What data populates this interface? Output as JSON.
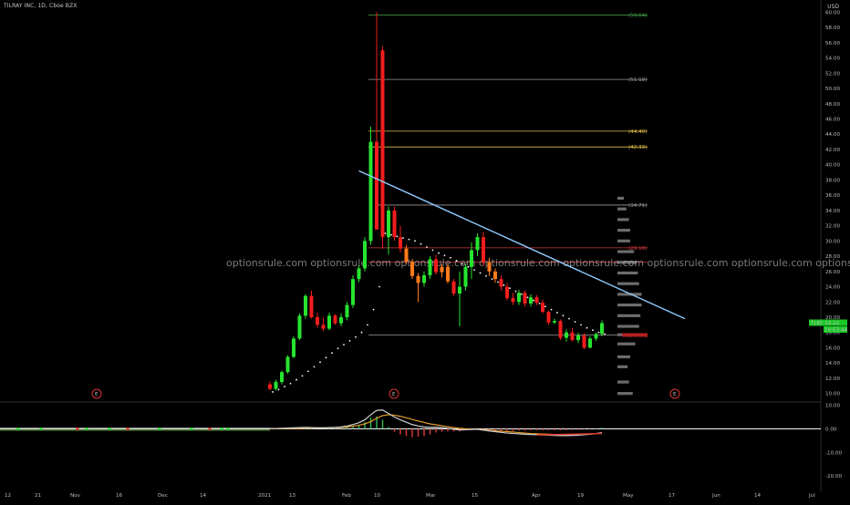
{
  "header": {
    "symbol": "TILRAY INC, 1D, Cboe BZX",
    "currency": "USD"
  },
  "watermark": "optionsrule.com optionsrule.com optionsrule.com optionsrule.com optionsrule.com optionsrule.com optionsrule.com optionsrule.com optionsrule.com optionsrule.com optionsrule.com",
  "price_tags": {
    "last": "TLRY 19.22",
    "countdown": "19:53:44"
  },
  "event_marker": "E",
  "colors": {
    "up": "#26e52f",
    "down": "#f21d1d",
    "pullback": "#ff7a1a",
    "trendline": "#8ecbff",
    "dots": "#ffffff",
    "level_green": "#48a84a",
    "level_gray": "#9a9a9a",
    "level_yellow": "#e0c24a",
    "level_red": "#d83a3a"
  },
  "chart_data": [
    {
      "type": "candlestick",
      "title": "TILRAY INC, 1D, Cboe BZX",
      "ylabel": "USD",
      "ylim": [
        9,
        61
      ],
      "y_ticks": [
        "10.00",
        "12.00",
        "14.00",
        "16.00",
        "18.00",
        "20.00",
        "22.00",
        "24.00",
        "26.00",
        "28.00",
        "30.00",
        "32.00",
        "34.00",
        "36.00",
        "38.00",
        "40.00",
        "42.00",
        "44.00",
        "46.00",
        "48.00",
        "50.00",
        "52.00",
        "54.00",
        "56.00",
        "58.00",
        "60.00"
      ],
      "x_ticks": [
        "12",
        "21",
        "Nov",
        "16",
        "Dec",
        "14",
        "2021",
        "13",
        "Feb",
        "10",
        "Mar",
        "15",
        "Apr",
        "19",
        "May",
        "17",
        "Jun",
        "14",
        "Jul"
      ],
      "levels": [
        {
          "label": "(59.64)",
          "value": 59.64,
          "color": "green"
        },
        {
          "label": "(51.18)",
          "value": 51.18,
          "color": "gray"
        },
        {
          "label": "(44.40)",
          "value": 44.4,
          "color": "yellow"
        },
        {
          "label": "(42.33)",
          "value": 42.33,
          "color": "yellow"
        },
        {
          "label": "(34.71)",
          "value": 34.71,
          "color": "gray"
        },
        {
          "label": "(29.10)",
          "value": 29.1,
          "color": "red"
        },
        {
          "label": "(17.67)",
          "value": 17.67,
          "color": "gray"
        }
      ],
      "candles": [
        {
          "o": 11.2,
          "h": 11.6,
          "l": 10.4,
          "c": 10.6
        },
        {
          "o": 10.6,
          "h": 11.8,
          "l": 10.4,
          "c": 11.5
        },
        {
          "o": 11.5,
          "h": 13.0,
          "l": 11.2,
          "c": 12.8
        },
        {
          "o": 12.8,
          "h": 15.0,
          "l": 12.6,
          "c": 14.8
        },
        {
          "o": 14.8,
          "h": 17.5,
          "l": 14.6,
          "c": 17.2
        },
        {
          "o": 17.2,
          "h": 20.5,
          "l": 17.0,
          "c": 20.2
        },
        {
          "o": 20.2,
          "h": 23.0,
          "l": 19.8,
          "c": 22.8
        },
        {
          "o": 22.8,
          "h": 23.5,
          "l": 19.8,
          "c": 20.0
        },
        {
          "o": 20.0,
          "h": 20.6,
          "l": 18.6,
          "c": 19.0
        },
        {
          "o": 19.0,
          "h": 19.9,
          "l": 18.2,
          "c": 18.5
        },
        {
          "o": 18.5,
          "h": 20.6,
          "l": 18.3,
          "c": 20.2
        },
        {
          "o": 20.2,
          "h": 20.4,
          "l": 19.0,
          "c": 19.2
        },
        {
          "o": 19.2,
          "h": 20.5,
          "l": 18.8,
          "c": 20.0
        },
        {
          "o": 20.0,
          "h": 22.0,
          "l": 19.6,
          "c": 21.6
        },
        {
          "o": 21.6,
          "h": 25.5,
          "l": 21.2,
          "c": 25.0
        },
        {
          "o": 25.0,
          "h": 26.8,
          "l": 24.6,
          "c": 26.4
        },
        {
          "o": 26.4,
          "h": 30.5,
          "l": 26.0,
          "c": 30.0
        },
        {
          "o": 30.0,
          "h": 45.0,
          "l": 29.5,
          "c": 43.0
        },
        {
          "o": 43.0,
          "h": 60.0,
          "l": 39.0,
          "c": 31.5
        },
        {
          "o": 55.0,
          "h": 55.5,
          "l": 29.0,
          "c": 30.5
        },
        {
          "o": 30.5,
          "h": 34.5,
          "l": 28.2,
          "c": 34.0
        },
        {
          "o": 34.0,
          "h": 34.5,
          "l": 30.0,
          "c": 30.5
        },
        {
          "o": 30.5,
          "h": 32.0,
          "l": 28.5,
          "c": 29.0
        },
        {
          "o": 29.0,
          "h": 29.5,
          "l": 27.0,
          "c": 27.3
        },
        {
          "o": 27.3,
          "h": 27.6,
          "l": 25.0,
          "c": 25.4
        },
        {
          "o": 25.4,
          "h": 25.8,
          "l": 22.0,
          "c": 24.5
        },
        {
          "o": 24.5,
          "h": 26.0,
          "l": 24.0,
          "c": 25.5
        },
        {
          "o": 25.5,
          "h": 28.0,
          "l": 25.0,
          "c": 27.6
        },
        {
          "o": 27.6,
          "h": 28.2,
          "l": 25.6,
          "c": 25.9
        },
        {
          "o": 25.9,
          "h": 27.0,
          "l": 25.2,
          "c": 26.6
        },
        {
          "o": 26.6,
          "h": 27.0,
          "l": 24.4,
          "c": 24.7
        },
        {
          "o": 24.7,
          "h": 25.0,
          "l": 22.8,
          "c": 23.1
        },
        {
          "o": 23.1,
          "h": 26.0,
          "l": 18.8,
          "c": 24.0
        },
        {
          "o": 24.0,
          "h": 27.0,
          "l": 23.5,
          "c": 26.6
        },
        {
          "o": 26.6,
          "h": 29.8,
          "l": 25.0,
          "c": 28.8
        },
        {
          "o": 28.8,
          "h": 31.0,
          "l": 28.0,
          "c": 30.5
        },
        {
          "o": 30.5,
          "h": 31.2,
          "l": 26.8,
          "c": 27.2
        },
        {
          "o": 27.2,
          "h": 27.8,
          "l": 25.4,
          "c": 26.0
        },
        {
          "o": 26.0,
          "h": 26.4,
          "l": 24.5,
          "c": 25.0
        },
        {
          "o": 25.0,
          "h": 25.5,
          "l": 23.5,
          "c": 24.0
        },
        {
          "o": 24.0,
          "h": 24.5,
          "l": 22.2,
          "c": 22.5
        },
        {
          "o": 22.5,
          "h": 23.2,
          "l": 21.6,
          "c": 22.0
        },
        {
          "o": 22.0,
          "h": 23.6,
          "l": 21.6,
          "c": 23.2
        },
        {
          "o": 23.2,
          "h": 23.5,
          "l": 21.4,
          "c": 21.8
        },
        {
          "o": 21.8,
          "h": 23.0,
          "l": 21.4,
          "c": 22.6
        },
        {
          "o": 22.6,
          "h": 22.9,
          "l": 21.6,
          "c": 21.9
        },
        {
          "o": 21.9,
          "h": 22.3,
          "l": 20.5,
          "c": 20.7
        },
        {
          "o": 20.7,
          "h": 20.9,
          "l": 19.0,
          "c": 19.3
        },
        {
          "o": 19.3,
          "h": 19.8,
          "l": 19.1,
          "c": 19.5
        },
        {
          "o": 19.5,
          "h": 19.7,
          "l": 17.0,
          "c": 17.3
        },
        {
          "o": 17.3,
          "h": 18.4,
          "l": 16.8,
          "c": 18.0
        },
        {
          "o": 18.0,
          "h": 18.6,
          "l": 16.8,
          "c": 17.0
        },
        {
          "o": 17.0,
          "h": 18.0,
          "l": 16.6,
          "c": 17.6
        },
        {
          "o": 17.6,
          "h": 17.9,
          "l": 15.8,
          "c": 16.0
        },
        {
          "o": 16.0,
          "h": 17.5,
          "l": 15.9,
          "c": 17.2
        },
        {
          "o": 17.2,
          "h": 18.0,
          "l": 16.9,
          "c": 17.8
        },
        {
          "o": 17.8,
          "h": 19.6,
          "l": 17.5,
          "c": 19.22
        }
      ],
      "sar_dots": [
        10.2,
        10.5,
        10.9,
        11.3,
        11.8,
        12.3,
        12.9,
        13.5,
        14.1,
        14.7,
        15.3,
        15.9,
        16.4,
        16.9,
        17.4,
        18.0,
        19.0,
        21.0,
        24.0,
        31.0,
        30.8,
        30.6,
        30.4,
        30.2,
        30.0,
        29.6,
        29.2,
        28.8,
        28.4,
        28.1,
        27.8,
        27.4,
        27.0,
        26.6,
        26.2,
        25.8,
        25.4,
        25.0,
        24.6,
        24.2,
        23.8,
        23.4,
        23.0,
        22.6,
        22.2,
        21.8,
        21.4,
        21.0,
        20.6,
        20.2,
        19.8,
        19.4,
        19.0,
        18.6,
        18.3,
        18.0,
        17.8
      ],
      "trendline": {
        "start": {
          "bar": 15,
          "price": 39.2
        },
        "end": {
          "bar": 70,
          "price": 19.8
        }
      },
      "volume_profile": [
        {
          "price": 10.0,
          "size": 0.6
        },
        {
          "price": 11.5,
          "size": 0.45
        },
        {
          "price": 13.5,
          "size": 0.4
        },
        {
          "price": 14.8,
          "size": 0.5
        },
        {
          "price": 16.5,
          "size": 0.7
        },
        {
          "price": 17.7,
          "size": 1.0
        },
        {
          "price": 18.8,
          "size": 0.85
        },
        {
          "price": 20.2,
          "size": 0.9
        },
        {
          "price": 21.6,
          "size": 0.95
        },
        {
          "price": 23.0,
          "size": 0.95
        },
        {
          "price": 24.4,
          "size": 0.85
        },
        {
          "price": 25.8,
          "size": 0.8
        },
        {
          "price": 27.2,
          "size": 0.75
        },
        {
          "price": 28.6,
          "size": 0.65
        },
        {
          "price": 30.0,
          "size": 0.5
        },
        {
          "price": 31.4,
          "size": 0.5
        },
        {
          "price": 32.8,
          "size": 0.45
        },
        {
          "price": 34.2,
          "size": 0.35
        },
        {
          "price": 35.6,
          "size": 0.25
        }
      ]
    },
    {
      "type": "line",
      "title": "",
      "ylim": [
        -25,
        11
      ],
      "y_ticks": [
        "10.00",
        "0.00",
        "-10.00",
        "-20.00"
      ],
      "series": [
        {
          "values": [
            0.1,
            0.1,
            0.2,
            0.3,
            0.4,
            0.5,
            0.6,
            0.5,
            0.4,
            0.4,
            0.5,
            0.6,
            0.8,
            1.2,
            1.8,
            2.6,
            3.8,
            6.0,
            7.8,
            8.0,
            6.5,
            5.0,
            3.8,
            2.8,
            1.8,
            1.2,
            0.8,
            0.6,
            0.7,
            0.5,
            0.2,
            -0.2,
            -0.5,
            -0.4,
            -0.3,
            -0.2,
            -0.6,
            -0.9,
            -1.2,
            -1.5,
            -1.8,
            -2.0,
            -2.1,
            -2.3,
            -2.4,
            -2.5,
            -2.6,
            -2.7,
            -2.8,
            -2.9,
            -2.9,
            -2.8,
            -2.7,
            -2.5,
            -2.3,
            -2.0,
            -1.6
          ]
        },
        {
          "values": [
            0.0,
            0.0,
            0.1,
            0.1,
            0.2,
            0.2,
            0.3,
            0.3,
            0.4,
            0.4,
            0.4,
            0.5,
            0.6,
            0.8,
            1.1,
            1.5,
            2.1,
            3.0,
            4.5,
            5.6,
            6.0,
            5.8,
            5.3,
            4.7,
            4.0,
            3.3,
            2.7,
            2.1,
            1.7,
            1.3,
            0.9,
            0.5,
            0.2,
            0.0,
            -0.1,
            -0.2,
            -0.4,
            -0.6,
            -0.8,
            -1.0,
            -1.2,
            -1.4,
            -1.6,
            -1.8,
            -2.0,
            -2.1,
            -2.2,
            -2.3,
            -2.4,
            -2.5,
            -2.5,
            -2.5,
            -2.4,
            -2.3,
            -2.2,
            -2.1,
            -1.9
          ]
        }
      ]
    }
  ]
}
